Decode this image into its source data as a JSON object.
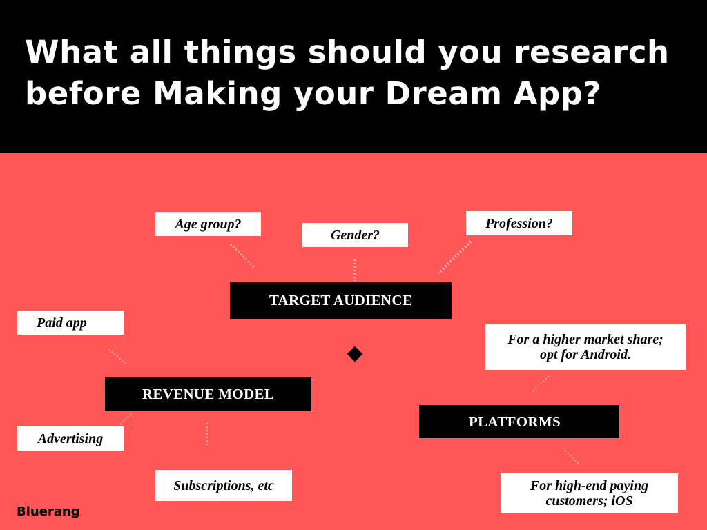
{
  "header": {
    "title_line1": "What all things should you research",
    "title_line2": "before Making your Dream App?"
  },
  "colors": {
    "background": "#ff5757",
    "header_bg": "#000000",
    "box_white": "#ffffff",
    "box_black": "#000000"
  },
  "hubs": {
    "target_audience": "TARGET AUDIENCE",
    "revenue_model": "REVENUE MODEL",
    "platforms": "PLATFORMS"
  },
  "notes": {
    "age_group": "Age group?",
    "gender": "Gender?",
    "profession": "Profession?",
    "paid_app": "Paid app",
    "advertising": "Advertising",
    "subscriptions": "Subscriptions, etc",
    "android_line1": "For a higher market share;",
    "android_line2": "opt for Android.",
    "ios_line1": "For high-end paying",
    "ios_line2": "customers; iOS"
  },
  "brand": "Bluerang"
}
